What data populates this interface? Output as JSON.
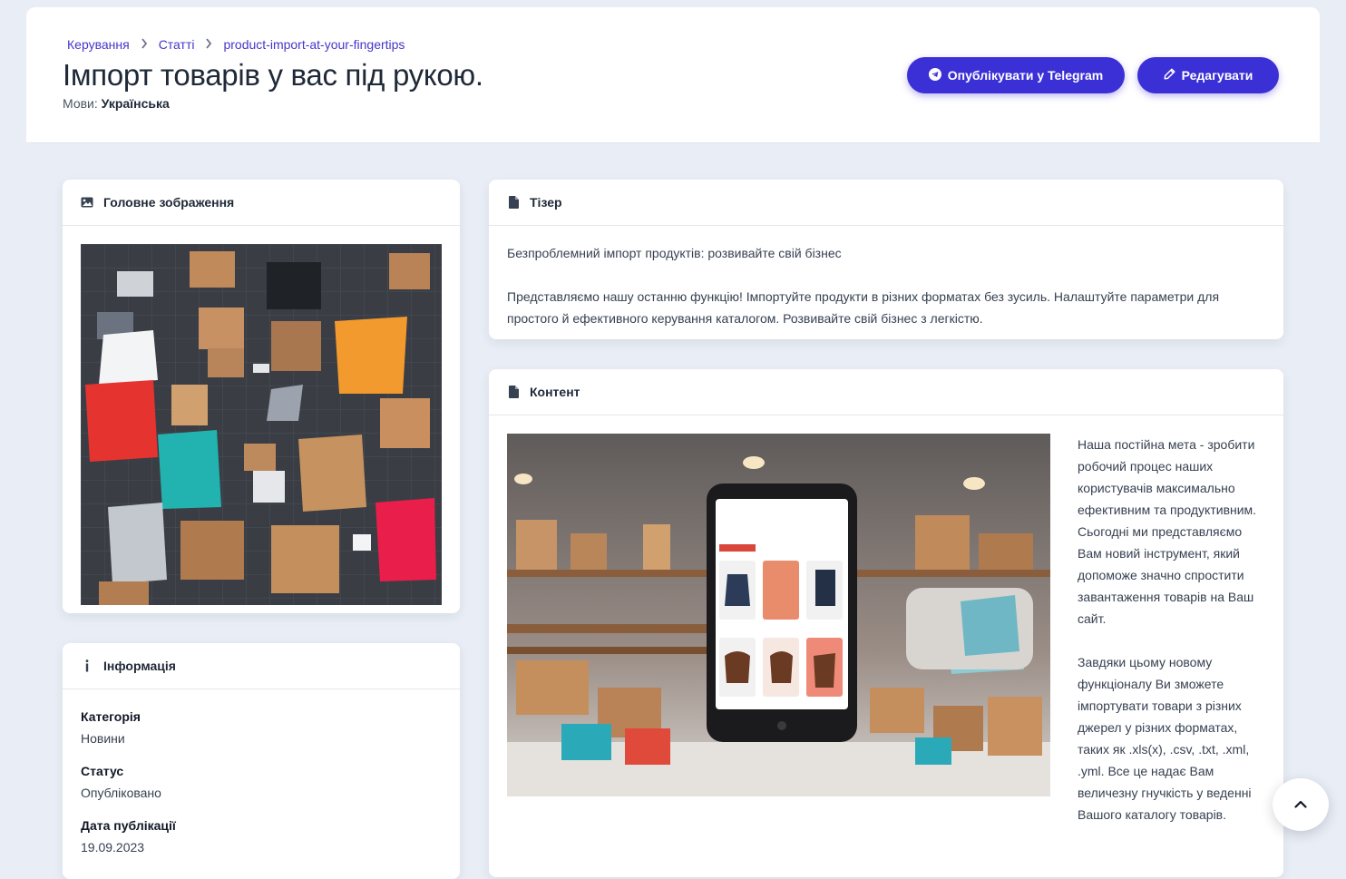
{
  "breadcrumbs": [
    "Керування",
    "Статті",
    "product-import-at-your-fingertips"
  ],
  "page": {
    "title": "Імпорт товарів у вас під рукою.",
    "languages_label": "Мови:",
    "languages_value": "Українська"
  },
  "actions": {
    "telegram_label": "Опублікувати у Telegram",
    "edit_label": "Редагувати"
  },
  "main_image_card": {
    "title": "Головне зображення",
    "icon": "image-icon"
  },
  "info_card": {
    "title": "Інформація",
    "icon": "info-icon",
    "fields": [
      {
        "label": "Категорія",
        "value": "Новини"
      },
      {
        "label": "Статус",
        "value": "Опубліковано"
      },
      {
        "label": "Дата публікації",
        "value": "19.09.2023"
      }
    ]
  },
  "teaser_card": {
    "title": "Тізер",
    "icon": "file-icon",
    "paragraphs": [
      "Безпроблемний імпорт продуктів: розвивайте свій бізнес",
      "Представляємо нашу останню функцію! Імпортуйте продукти в різних форматах без зусиль. Налаштуйте параметри для простого й ефективного керування каталогом. Розвивайте свій бізнес з легкістю."
    ]
  },
  "content_card": {
    "title": "Контент",
    "icon": "file-icon",
    "paragraphs": [
      "Наша постійна мета - зробити робочий процес наших користувачів максимально ефективним та продуктивним. Сьогодні ми представляємо Вам новий інструмент, який допоможе значно спростити завантаження товарів на Ваш сайт.",
      "Завдяки цьому новому функціоналу Ви зможете імпортувати товари з різних джерел у різних форматах, таких як .xls(x), .csv, .txt, .xml, .yml. Все це надає Вам величезну гнучкість у веденні Вашого каталогу товарів."
    ]
  },
  "colors": {
    "accent": "#3b2fd6",
    "link": "#4338ca",
    "background": "#e9eef6"
  }
}
